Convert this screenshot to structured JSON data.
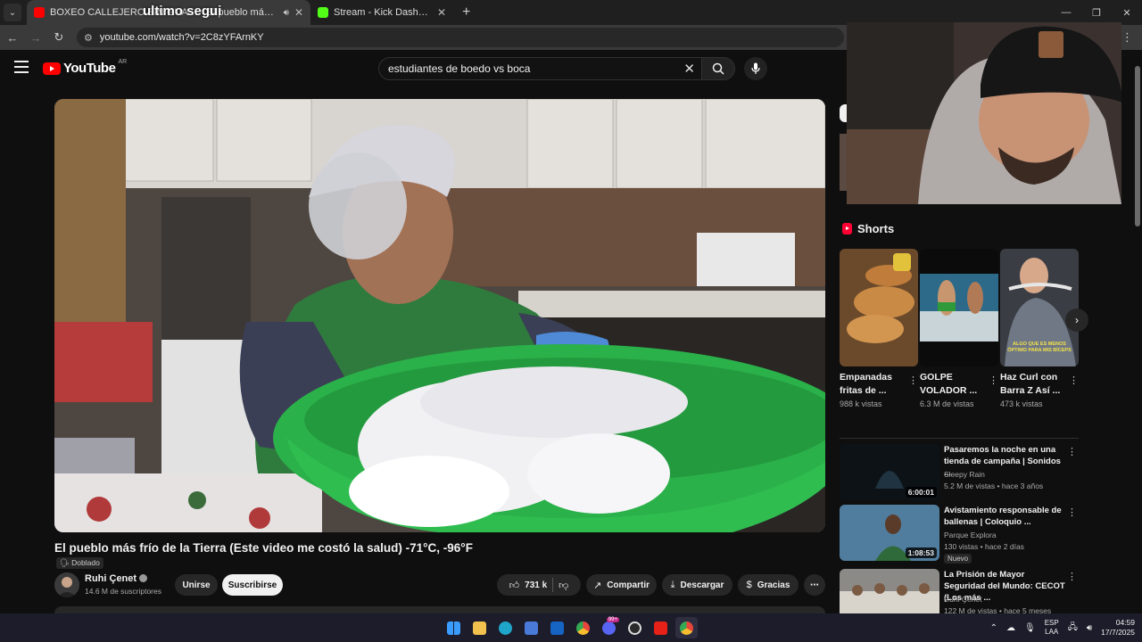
{
  "browser": {
    "tabs": [
      {
        "label": "BOXEO CALLEJERO SIN GUANTES",
        "active": false
      },
      {
        "label": "El pueblo más frío de la Tierra",
        "active": true
      },
      {
        "label": "Stream - Kick Dashboard",
        "active": false
      }
    ],
    "stream_overlay_text": "ultimo segui",
    "url": "youtube.com/watch?v=2C8zYFArnKY",
    "new_tab": "+"
  },
  "youtube": {
    "logo_text": "YouTube",
    "country_code": "AR",
    "search_value": "estudiantes de boedo vs boca"
  },
  "video": {
    "title": "El pueblo más frío de la Tierra (Este video me costó la salud) -71°C, -96°F",
    "badge": "Doblado",
    "channel_name": "Ruhi Çenet",
    "subscribers": "14.6 M de suscriptores",
    "join_label": "Unirse",
    "subscribe_label": "Suscribirse",
    "likes": "731 k",
    "share_label": "Compartir",
    "download_label": "Descargar",
    "thanks_label": "Gracias"
  },
  "shorts": {
    "heading": "Shorts",
    "items": [
      {
        "title": "Empanadas fritas de ...",
        "views": "988 k vistas"
      },
      {
        "title": "GOLPE VOLADOR ...",
        "views": "6.3 M de vistas"
      },
      {
        "title": "Haz Curl con Barra Z Así ...",
        "views": "473 k vistas",
        "thumb_caption": "ALGO QUE ES MENOS ÓPTIMO PARA MIS BÍCEPS"
      }
    ]
  },
  "recommendations": [
    {
      "title": "Pasaremos la noche en una tienda de campaña | Sonidos ...",
      "channel": "Sleepy Rain",
      "meta": "5.2 M de vistas • hace 3 años",
      "duration": "6:00:01"
    },
    {
      "title": "Avistamiento responsable de ballenas | Coloquio ...",
      "channel": "Parque Explora",
      "meta": "130 vistas • hace 2 días",
      "duration": "1:08:53",
      "badge": "Nuevo"
    },
    {
      "title": "La Prisión de Mayor Seguridad del Mundo: CECOT (Los más ...",
      "channel": "Ruhi Çenet",
      "meta": "122 M de vistas • hace 5 meses"
    }
  ],
  "taskbar": {
    "lang_top": "ESP",
    "lang_bottom": "LAA",
    "time": "04:59",
    "date": "17/7/2025",
    "notif_badge": "99+"
  },
  "colors": {
    "youtube_red": "#ff0000",
    "kick_green": "#53fc18",
    "bg": "#0f0f0f"
  }
}
